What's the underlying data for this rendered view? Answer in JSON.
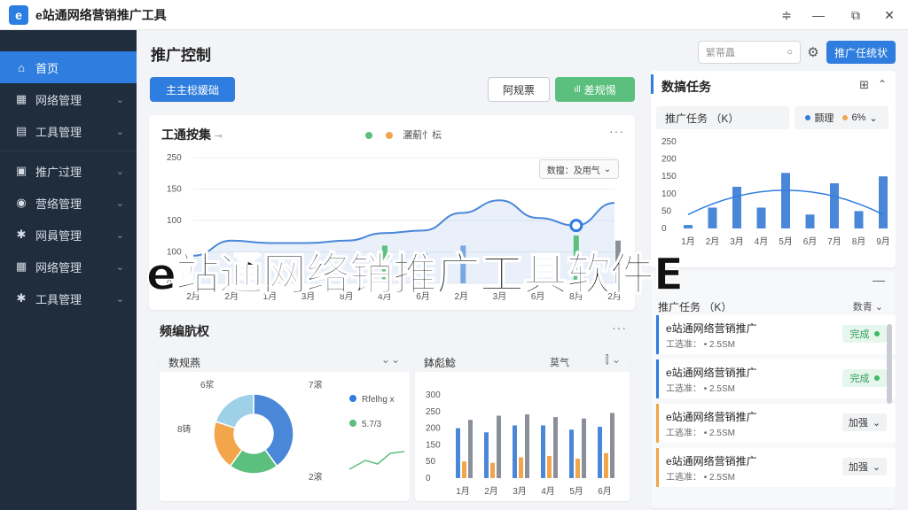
{
  "titlebar": {
    "logo": "e",
    "title": "e站通网络营销推广工具",
    "controls": [
      "≑",
      "—",
      "⧉",
      "✕"
    ]
  },
  "sidebar": {
    "items": [
      {
        "label": "首页",
        "icon": "home-icon",
        "glyph": "⌂",
        "active": true
      },
      {
        "label": "网络管理",
        "icon": "grid-icon",
        "glyph": "▦"
      },
      {
        "label": "工具管理",
        "icon": "document-icon",
        "glyph": "▤"
      },
      {
        "label": "推广过理",
        "icon": "note-icon",
        "glyph": "▣"
      },
      {
        "label": "营络管理",
        "icon": "user-icon",
        "glyph": "◉"
      },
      {
        "label": "网員管理",
        "icon": "gear-icon",
        "glyph": "✱"
      },
      {
        "label": "网络管理",
        "icon": "grid-icon",
        "glyph": "▦"
      },
      {
        "label": "工具管理",
        "icon": "gear-icon",
        "glyph": "✱"
      }
    ]
  },
  "header": {
    "title": "推广控制",
    "search_placeholder": "繁蒂矗",
    "action_button": "推广任统状"
  },
  "toolbar": {
    "primary_button": "主主棇媛础",
    "secondary_button": "阿规票",
    "green_button": "差规惕"
  },
  "main_chart_card": {
    "title": "工通按集",
    "legend": "灑葪忄枟",
    "dropdown": "数擅：及用气",
    "chart_data": {
      "type": "line",
      "categories": [
        "2月",
        "2月",
        "1月",
        "3月",
        "8月",
        "4月",
        "6月",
        "2月",
        "3月",
        "6月",
        "8月",
        "2月"
      ],
      "y_ticks": [
        0,
        100,
        100,
        150,
        250
      ],
      "ylim": [
        0,
        250
      ],
      "series": [
        {
          "type": "area",
          "color": "#4a87d8",
          "values": [
            55,
            85,
            80,
            80,
            85,
            100,
            105,
            140,
            165,
            130,
            115,
            160
          ]
        },
        {
          "type": "bar",
          "color": "#5bbf7e",
          "values": [
            0,
            0,
            0,
            0,
            0,
            75,
            0,
            0,
            0,
            0,
            95,
            0
          ]
        },
        {
          "type": "bar",
          "color": "#7aa7e0",
          "values": [
            0,
            0,
            0,
            0,
            0,
            0,
            60,
            75,
            0,
            0,
            0,
            0
          ]
        },
        {
          "type": "bar",
          "color": "#8a8f99",
          "values": [
            0,
            0,
            0,
            0,
            0,
            0,
            0,
            0,
            0,
            0,
            0,
            85
          ]
        }
      ]
    }
  },
  "bottom_section": {
    "title": "频编肮权",
    "donut_card": {
      "title": "数规燕",
      "labels": [
        "6浆",
        "7滚",
        "8铸",
        "2滚"
      ],
      "legend": [
        {
          "label": "Rfelhg x",
          "color": "#2f7ddf"
        },
        {
          "label": "5.7/3",
          "color": "#5bbf7e"
        }
      ],
      "chart_data": {
        "type": "pie",
        "values": [
          40,
          20,
          20,
          20
        ],
        "colors": [
          "#4a87d8",
          "#5bbf7e",
          "#f2a54a",
          "#9ed0e8"
        ]
      }
    },
    "bar_card": {
      "title": "鉢彪鯰",
      "extra": "莫气",
      "chart_data": {
        "type": "bar",
        "categories": [
          "1月",
          "2月",
          "3月",
          "4月",
          "5月",
          "6月"
        ],
        "y_ticks": [
          0,
          50,
          150,
          200,
          250,
          300
        ],
        "ylim": [
          0,
          300
        ],
        "series": [
          {
            "color": "#4a87d8",
            "values": [
              180,
              165,
              190,
              190,
              175,
              185
            ]
          },
          {
            "color": "#f2a54a",
            "values": [
              60,
              55,
              75,
              80,
              70,
              90
            ]
          },
          {
            "color": "#8a8f99",
            "values": [
              210,
              225,
              230,
              220,
              215,
              235
            ]
          }
        ]
      }
    }
  },
  "task_card": {
    "title": "数搞任务",
    "filter": "推广任务 （K）",
    "legend": [
      {
        "label": "颢理",
        "color": "#2f7ddf"
      },
      {
        "label": "6%",
        "color": "#f2a54a"
      }
    ],
    "chart_data": {
      "type": "bar",
      "categories": [
        "1月",
        "2月",
        "3月",
        "4月",
        "5月",
        "6月",
        "7月",
        "8月",
        "9月"
      ],
      "y_ticks": [
        0,
        50,
        100,
        150,
        200,
        250
      ],
      "ylim": [
        0,
        250
      ],
      "values": [
        10,
        60,
        120,
        60,
        160,
        40,
        130,
        50,
        150
      ]
    }
  },
  "task_list": {
    "filter": "推广任务 （K）",
    "sort_label": "数青",
    "items": [
      {
        "title": "e站通网络营销推广",
        "sub": "工选准： • 2.5SM",
        "status": "完成",
        "kind": "green"
      },
      {
        "title": "e站通网络营销推广",
        "sub": "工选准： • 2.5SM",
        "status": "完成",
        "kind": "green"
      },
      {
        "title": "e站通网络营销推广",
        "sub": "工逃准： • 2.5SM",
        "status": "加强",
        "kind": "gray"
      },
      {
        "title": "e站通网络营销推广",
        "sub": "工逃准： • 2.5SM",
        "status": "加强",
        "kind": "gray"
      }
    ]
  },
  "overlay_text": "e站通网络销推广工具软件E",
  "colors": {
    "accent": "#2f7ddf",
    "sidebar": "#1f2d3d",
    "green": "#5bbf7e",
    "orange": "#f2a54a"
  }
}
